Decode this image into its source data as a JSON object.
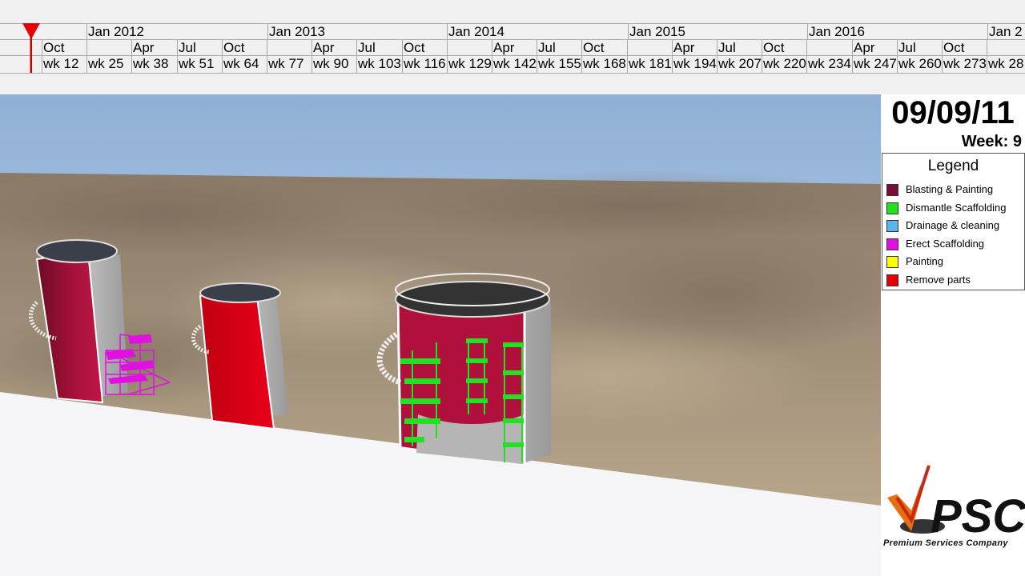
{
  "timeline": {
    "years": [
      "Jan 2012",
      "Jan 2013",
      "Jan 2014",
      "Jan 2015",
      "Jan 2016",
      "Jan 2"
    ],
    "months": [
      "Oct",
      "",
      "Apr",
      "Jul",
      "Oct",
      "",
      "Apr",
      "Jul",
      "Oct",
      "",
      "Apr",
      "Jul",
      "Oct",
      "",
      "Apr",
      "Jul",
      "Oct",
      "",
      "Apr",
      "Jul",
      "Oct",
      ""
    ],
    "weeks": [
      "wk 12",
      "wk 25",
      "wk 38",
      "wk 51",
      "wk 64",
      "wk 77",
      "wk 90",
      "wk 103",
      "wk 116",
      "wk 129",
      "wk 142",
      "wk 155",
      "wk 168",
      "wk 181",
      "wk 194",
      "wk 207",
      "wk 220",
      "wk 234",
      "wk 247",
      "wk 260",
      "wk 273",
      "wk 28"
    ],
    "marker_color": "#e60000"
  },
  "status": {
    "date": "09/09/11",
    "week": "Week: 9"
  },
  "legend": {
    "title": "Legend",
    "items": [
      {
        "label": "Blasting & Painting",
        "color": "#7a0d3a"
      },
      {
        "label": "Dismantle Scaffolding",
        "color": "#22e022"
      },
      {
        "label": "Drainage & cleaning",
        "color": "#5ab6ea"
      },
      {
        "label": "Erect Scaffolding",
        "color": "#e010e0"
      },
      {
        "label": "Painting",
        "color": "#ffff00"
      },
      {
        "label": "Remove parts",
        "color": "#e60000"
      }
    ]
  },
  "logo": {
    "text": "PSC",
    "tagline": "Premium Services Company"
  }
}
